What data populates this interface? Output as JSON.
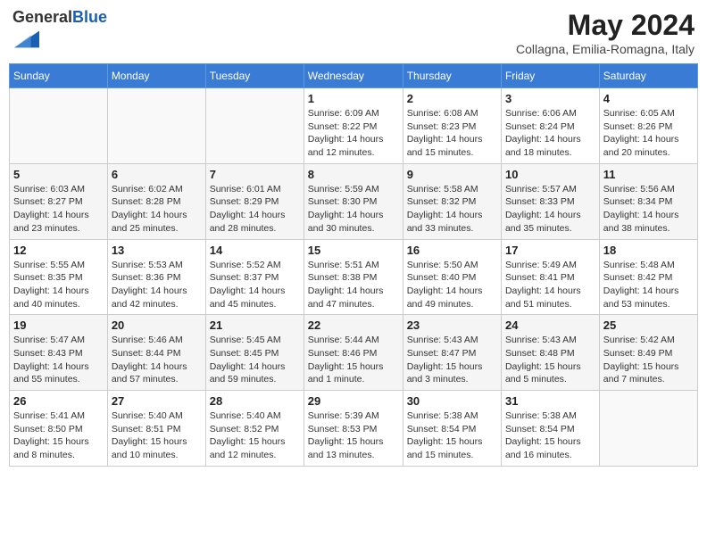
{
  "header": {
    "logo_general": "General",
    "logo_blue": "Blue",
    "month_title": "May 2024",
    "subtitle": "Collagna, Emilia-Romagna, Italy"
  },
  "weekdays": [
    "Sunday",
    "Monday",
    "Tuesday",
    "Wednesday",
    "Thursday",
    "Friday",
    "Saturday"
  ],
  "weeks": [
    [
      {
        "day": "",
        "info": ""
      },
      {
        "day": "",
        "info": ""
      },
      {
        "day": "",
        "info": ""
      },
      {
        "day": "1",
        "info": "Sunrise: 6:09 AM\nSunset: 8:22 PM\nDaylight: 14 hours\nand 12 minutes."
      },
      {
        "day": "2",
        "info": "Sunrise: 6:08 AM\nSunset: 8:23 PM\nDaylight: 14 hours\nand 15 minutes."
      },
      {
        "day": "3",
        "info": "Sunrise: 6:06 AM\nSunset: 8:24 PM\nDaylight: 14 hours\nand 18 minutes."
      },
      {
        "day": "4",
        "info": "Sunrise: 6:05 AM\nSunset: 8:26 PM\nDaylight: 14 hours\nand 20 minutes."
      }
    ],
    [
      {
        "day": "5",
        "info": "Sunrise: 6:03 AM\nSunset: 8:27 PM\nDaylight: 14 hours\nand 23 minutes."
      },
      {
        "day": "6",
        "info": "Sunrise: 6:02 AM\nSunset: 8:28 PM\nDaylight: 14 hours\nand 25 minutes."
      },
      {
        "day": "7",
        "info": "Sunrise: 6:01 AM\nSunset: 8:29 PM\nDaylight: 14 hours\nand 28 minutes."
      },
      {
        "day": "8",
        "info": "Sunrise: 5:59 AM\nSunset: 8:30 PM\nDaylight: 14 hours\nand 30 minutes."
      },
      {
        "day": "9",
        "info": "Sunrise: 5:58 AM\nSunset: 8:32 PM\nDaylight: 14 hours\nand 33 minutes."
      },
      {
        "day": "10",
        "info": "Sunrise: 5:57 AM\nSunset: 8:33 PM\nDaylight: 14 hours\nand 35 minutes."
      },
      {
        "day": "11",
        "info": "Sunrise: 5:56 AM\nSunset: 8:34 PM\nDaylight: 14 hours\nand 38 minutes."
      }
    ],
    [
      {
        "day": "12",
        "info": "Sunrise: 5:55 AM\nSunset: 8:35 PM\nDaylight: 14 hours\nand 40 minutes."
      },
      {
        "day": "13",
        "info": "Sunrise: 5:53 AM\nSunset: 8:36 PM\nDaylight: 14 hours\nand 42 minutes."
      },
      {
        "day": "14",
        "info": "Sunrise: 5:52 AM\nSunset: 8:37 PM\nDaylight: 14 hours\nand 45 minutes."
      },
      {
        "day": "15",
        "info": "Sunrise: 5:51 AM\nSunset: 8:38 PM\nDaylight: 14 hours\nand 47 minutes."
      },
      {
        "day": "16",
        "info": "Sunrise: 5:50 AM\nSunset: 8:40 PM\nDaylight: 14 hours\nand 49 minutes."
      },
      {
        "day": "17",
        "info": "Sunrise: 5:49 AM\nSunset: 8:41 PM\nDaylight: 14 hours\nand 51 minutes."
      },
      {
        "day": "18",
        "info": "Sunrise: 5:48 AM\nSunset: 8:42 PM\nDaylight: 14 hours\nand 53 minutes."
      }
    ],
    [
      {
        "day": "19",
        "info": "Sunrise: 5:47 AM\nSunset: 8:43 PM\nDaylight: 14 hours\nand 55 minutes."
      },
      {
        "day": "20",
        "info": "Sunrise: 5:46 AM\nSunset: 8:44 PM\nDaylight: 14 hours\nand 57 minutes."
      },
      {
        "day": "21",
        "info": "Sunrise: 5:45 AM\nSunset: 8:45 PM\nDaylight: 14 hours\nand 59 minutes."
      },
      {
        "day": "22",
        "info": "Sunrise: 5:44 AM\nSunset: 8:46 PM\nDaylight: 15 hours\nand 1 minute."
      },
      {
        "day": "23",
        "info": "Sunrise: 5:43 AM\nSunset: 8:47 PM\nDaylight: 15 hours\nand 3 minutes."
      },
      {
        "day": "24",
        "info": "Sunrise: 5:43 AM\nSunset: 8:48 PM\nDaylight: 15 hours\nand 5 minutes."
      },
      {
        "day": "25",
        "info": "Sunrise: 5:42 AM\nSunset: 8:49 PM\nDaylight: 15 hours\nand 7 minutes."
      }
    ],
    [
      {
        "day": "26",
        "info": "Sunrise: 5:41 AM\nSunset: 8:50 PM\nDaylight: 15 hours\nand 8 minutes."
      },
      {
        "day": "27",
        "info": "Sunrise: 5:40 AM\nSunset: 8:51 PM\nDaylight: 15 hours\nand 10 minutes."
      },
      {
        "day": "28",
        "info": "Sunrise: 5:40 AM\nSunset: 8:52 PM\nDaylight: 15 hours\nand 12 minutes."
      },
      {
        "day": "29",
        "info": "Sunrise: 5:39 AM\nSunset: 8:53 PM\nDaylight: 15 hours\nand 13 minutes."
      },
      {
        "day": "30",
        "info": "Sunrise: 5:38 AM\nSunset: 8:54 PM\nDaylight: 15 hours\nand 15 minutes."
      },
      {
        "day": "31",
        "info": "Sunrise: 5:38 AM\nSunset: 8:54 PM\nDaylight: 15 hours\nand 16 minutes."
      },
      {
        "day": "",
        "info": ""
      }
    ]
  ]
}
